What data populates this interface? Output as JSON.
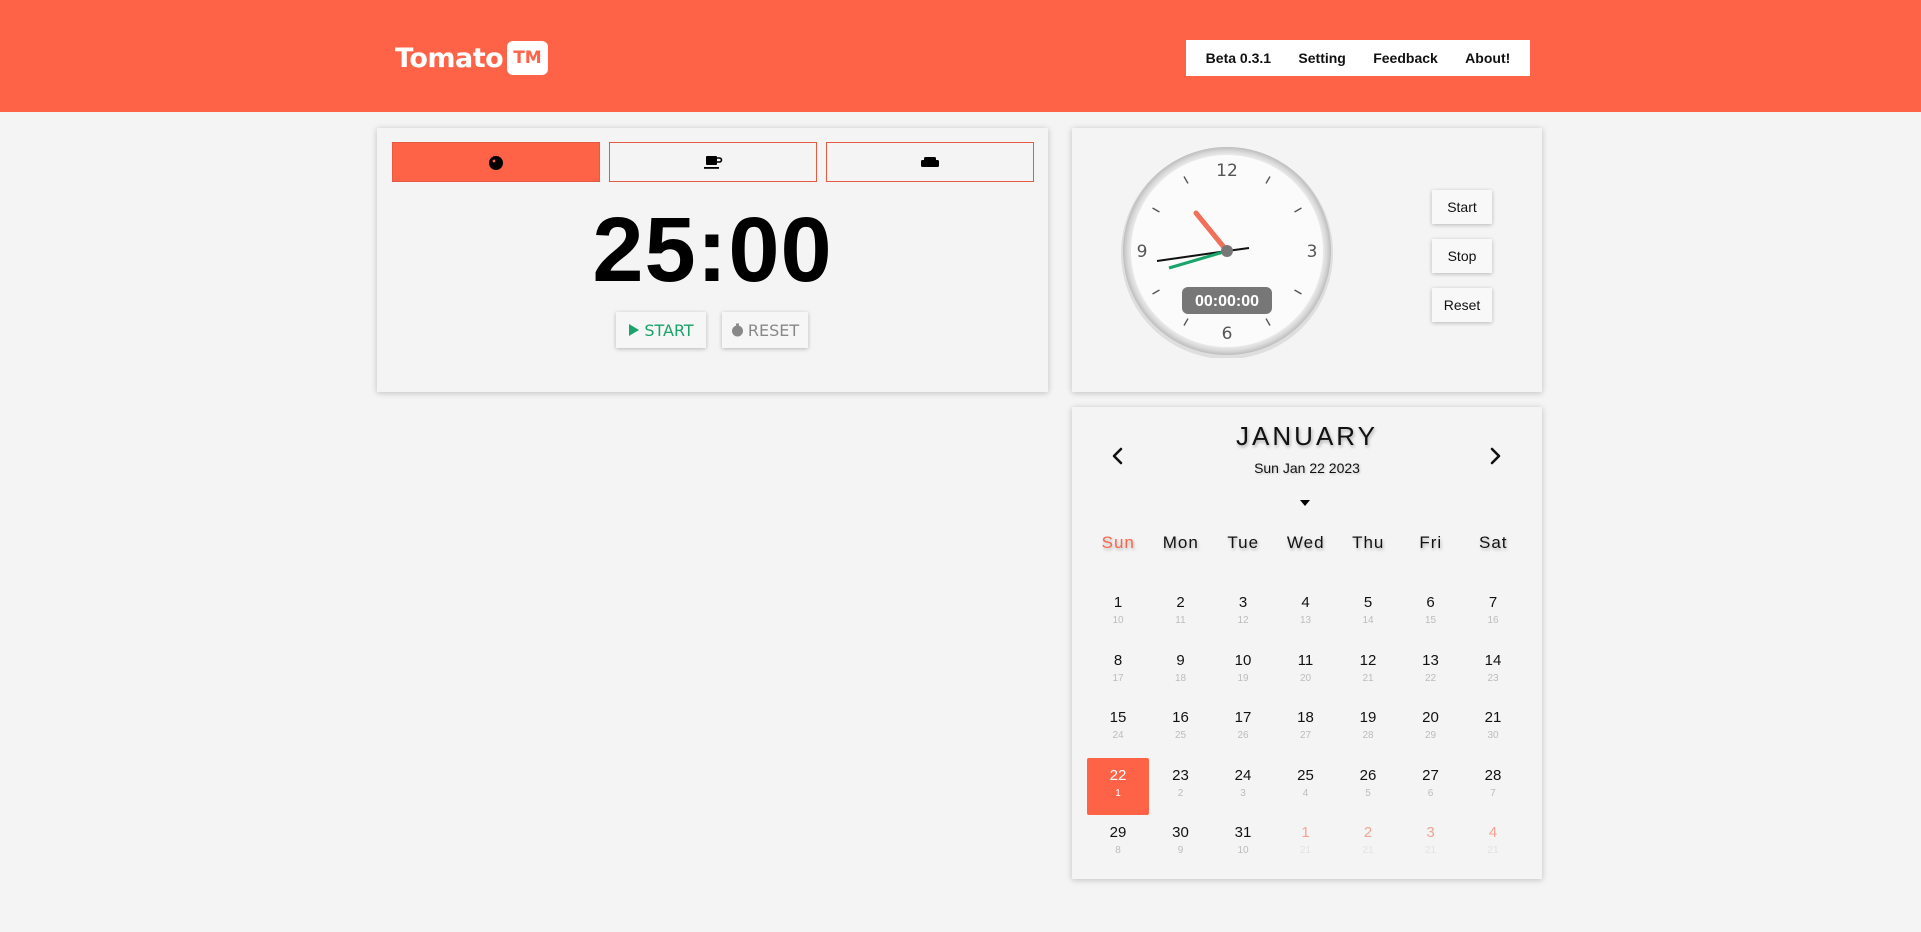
{
  "brand": {
    "name": "Tomato",
    "badge": "TM"
  },
  "nav": [
    "Beta 0.3.1",
    "Setting",
    "Feedback",
    "About!"
  ],
  "timer": {
    "tabs": [
      {
        "icon": "tomato-icon",
        "active": true
      },
      {
        "icon": "coffee-cup-icon",
        "active": false
      },
      {
        "icon": "couch-icon",
        "active": false
      }
    ],
    "time": "25:00",
    "start_label": "START",
    "reset_label": "RESET"
  },
  "stopwatch": {
    "face_numbers": [
      "12",
      "3",
      "6",
      "9"
    ],
    "display": "00:00:00",
    "buttons": [
      "Start",
      "Stop",
      "Reset"
    ]
  },
  "calendar": {
    "month": "JANUARY",
    "current_date": "Sun Jan 22 2023",
    "weekdays": [
      "Sun",
      "Mon",
      "Tue",
      "Wed",
      "Thu",
      "Fri",
      "Sat"
    ],
    "days": [
      {
        "n": "1",
        "l": "10"
      },
      {
        "n": "2",
        "l": "11"
      },
      {
        "n": "3",
        "l": "12"
      },
      {
        "n": "4",
        "l": "13"
      },
      {
        "n": "5",
        "l": "14"
      },
      {
        "n": "6",
        "l": "15"
      },
      {
        "n": "7",
        "l": "16"
      },
      {
        "n": "8",
        "l": "17"
      },
      {
        "n": "9",
        "l": "18"
      },
      {
        "n": "10",
        "l": "19"
      },
      {
        "n": "11",
        "l": "20"
      },
      {
        "n": "12",
        "l": "21"
      },
      {
        "n": "13",
        "l": "22"
      },
      {
        "n": "14",
        "l": "23"
      },
      {
        "n": "15",
        "l": "24"
      },
      {
        "n": "16",
        "l": "25"
      },
      {
        "n": "17",
        "l": "26"
      },
      {
        "n": "18",
        "l": "27"
      },
      {
        "n": "19",
        "l": "28"
      },
      {
        "n": "20",
        "l": "29"
      },
      {
        "n": "21",
        "l": "30"
      },
      {
        "n": "22",
        "l": "1",
        "today": true
      },
      {
        "n": "23",
        "l": "2"
      },
      {
        "n": "24",
        "l": "3"
      },
      {
        "n": "25",
        "l": "4"
      },
      {
        "n": "26",
        "l": "5"
      },
      {
        "n": "27",
        "l": "6"
      },
      {
        "n": "28",
        "l": "7"
      },
      {
        "n": "29",
        "l": "8"
      },
      {
        "n": "30",
        "l": "9"
      },
      {
        "n": "31",
        "l": "10"
      },
      {
        "n": "1",
        "l": "21",
        "other": true
      },
      {
        "n": "2",
        "l": "21",
        "other": true
      },
      {
        "n": "3",
        "l": "21",
        "other": true
      },
      {
        "n": "4",
        "l": "21",
        "other": true
      }
    ]
  },
  "colors": {
    "accent": "#ff6347",
    "start_green": "#1aa36a",
    "reset_gray": "#888888",
    "second_hand": "#1aa36a",
    "hour_hand": "#f0705a"
  }
}
